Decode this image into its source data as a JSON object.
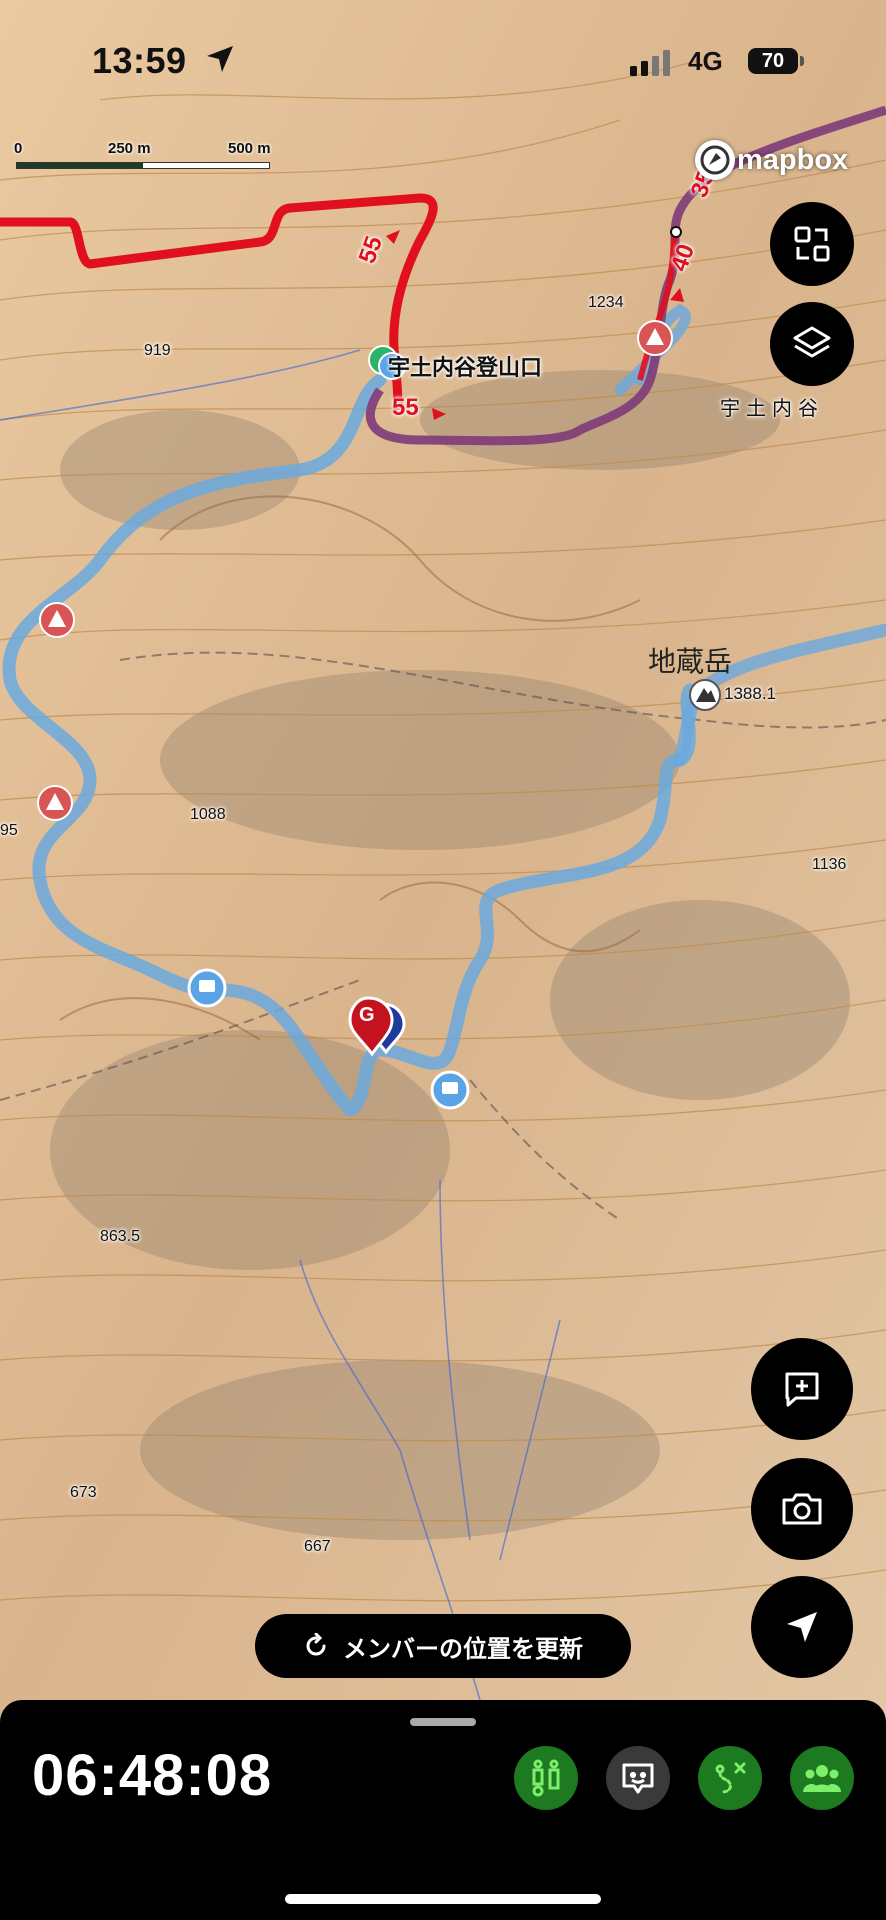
{
  "status_bar": {
    "time": "13:59",
    "network": "4G",
    "battery": "70"
  },
  "scale": {
    "labels": [
      "0",
      "250 m",
      "500 m"
    ]
  },
  "attribution": {
    "brand": "mapbox"
  },
  "map_labels": {
    "trailhead": "宇土内谷登山口",
    "valley": "宇土内谷",
    "peak_name": "地蔵岳",
    "peak_elev": "1388.1",
    "elevations": [
      "1234",
      "919",
      "1088",
      "1136",
      "863.5",
      "673",
      "667",
      "95"
    ],
    "route_numbers": [
      "55",
      "55",
      "40",
      "35"
    ],
    "goal_marker": "G"
  },
  "map_buttons": [
    {
      "name": "fullscreen",
      "icon": "expand-icon"
    },
    {
      "name": "layers",
      "icon": "layers-icon"
    },
    {
      "name": "add-note",
      "icon": "add-note-icon"
    },
    {
      "name": "camera",
      "icon": "camera-icon"
    },
    {
      "name": "locate",
      "icon": "navigation-arrow-icon"
    }
  ],
  "refresh_button": {
    "label": "メンバーの位置を更新"
  },
  "bottom_panel": {
    "elapsed": "06:48:08",
    "actions": [
      "hiker-info-icon",
      "chat-icon",
      "route-icon",
      "group-icon"
    ]
  },
  "colors": {
    "route_red": "#e0101e",
    "route_purple": "#7e3b78",
    "track_blue": "#6aa9de",
    "action_green": "#1e7a21"
  }
}
